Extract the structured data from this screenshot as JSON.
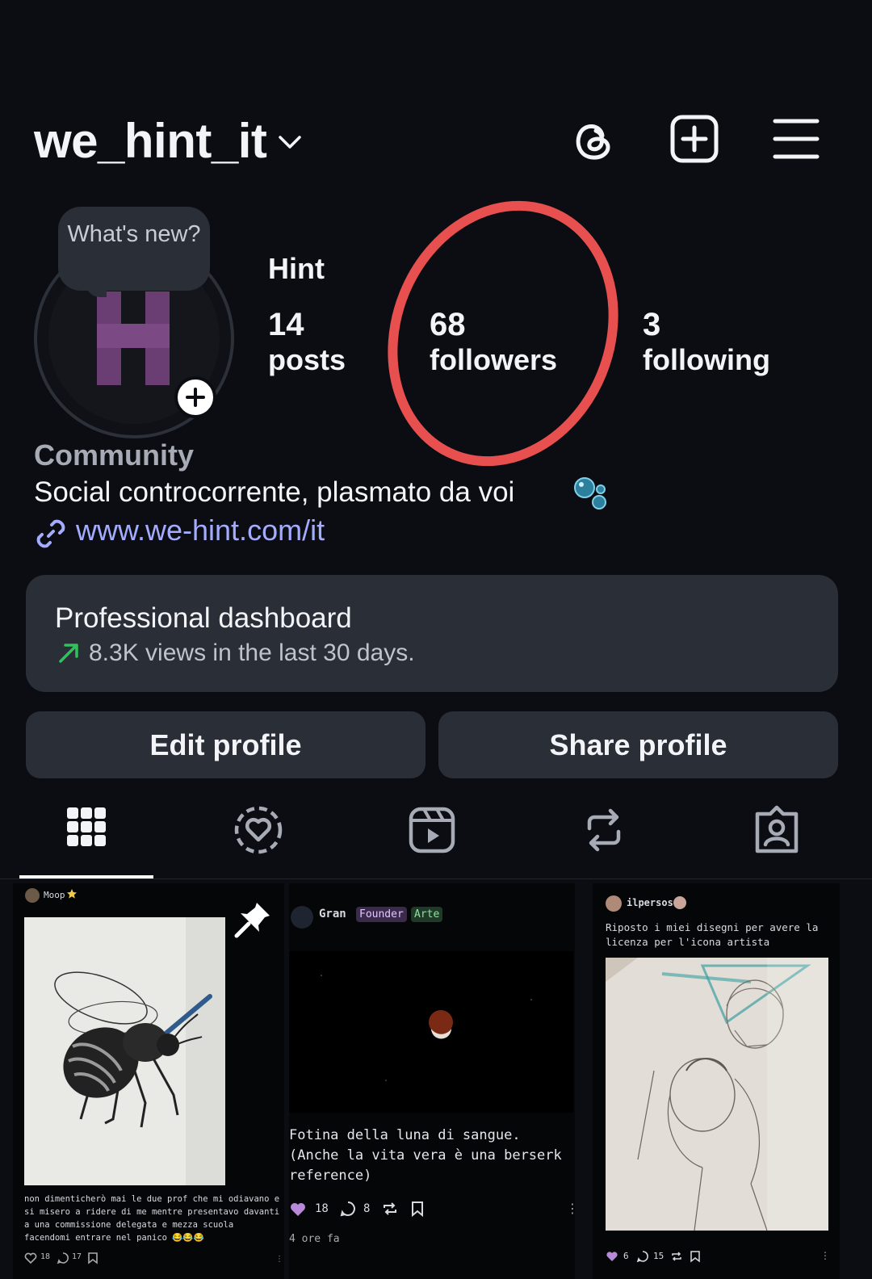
{
  "header": {
    "username": "we_hint_it",
    "icons": [
      "chevron-down-icon",
      "threads-icon",
      "create-post-icon",
      "menu-icon"
    ]
  },
  "avatar": {
    "note_bubble": "What's new?",
    "letter_mark": "H",
    "add_icon": "plus-icon"
  },
  "profile": {
    "display_name": "Hint",
    "stats": {
      "posts": {
        "count": "14",
        "label": "posts"
      },
      "followers": {
        "count": "68",
        "label": "followers"
      },
      "following": {
        "count": "3",
        "label": "following"
      }
    },
    "category": "Community",
    "bio": "Social controcorrente, plasmato da voi",
    "link": "www.we-hint.com/it",
    "highlight_color": "#e85050"
  },
  "dashboard": {
    "title": "Professional dashboard",
    "subtitle": "8.3K views in the last 30 days.",
    "trend_color": "#2fc25b"
  },
  "buttons": {
    "edit": "Edit profile",
    "share": "Share profile"
  },
  "tabs": [
    "grid-icon",
    "heart-story-icon",
    "reels-icon",
    "repost-icon",
    "tagged-icon"
  ],
  "grid": [
    {
      "author": "Moop",
      "caption": "non dimenticherò mai le due prof che mi odiavano e si misero a ridere di me mentre presentavo davanti a una commissione delegata e mezza scuola facendomi entrare nel panico 😂😂😂",
      "likes": "18",
      "comments": "17",
      "pinned": true
    },
    {
      "author": "Gran",
      "badges": [
        "Founder",
        "Arte"
      ],
      "caption": "Fotina della luna di sangue. (Anche la vita vera è una berserk reference)",
      "likes": "18",
      "comments": "8",
      "time": "4 ore fa"
    },
    {
      "author": "ilpersos",
      "caption": "Riposto i miei disegni per avere la licenza per l'icona artista",
      "likes": "6",
      "comments": "15"
    }
  ]
}
